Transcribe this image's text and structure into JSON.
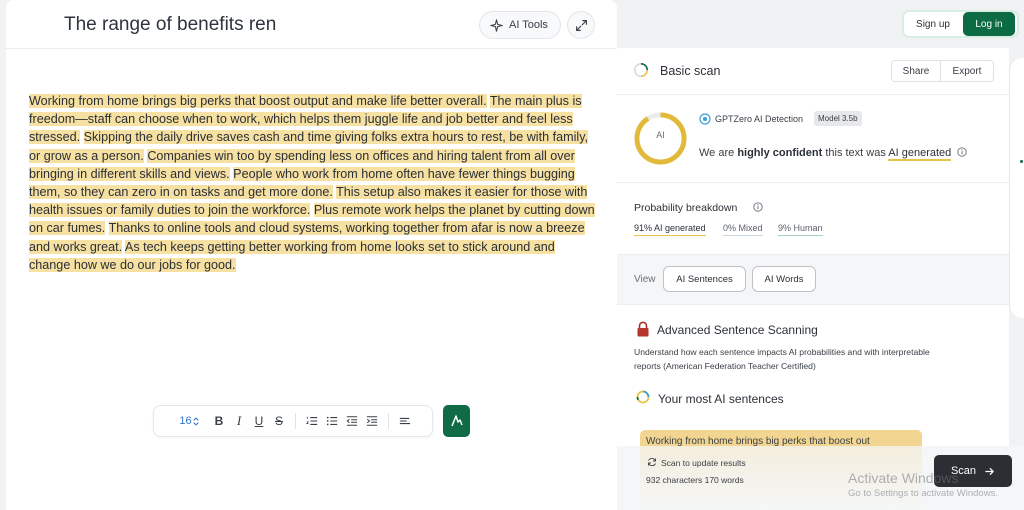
{
  "editor": {
    "title": "The range of benefits ren",
    "ai_tools_label": "AI Tools",
    "sentences": [
      "Working from home brings big perks that boost output and make life better overall.",
      "The main plus is freedom—staff can choose when to work, which helps them juggle life and job better and feel less stressed.",
      "Skipping the daily drive saves cash and time giving folks extra hours to rest, be with family, or grow as a person.",
      "Companies win too by spending less on offices and hiring talent from all over bringing in different skills and views.",
      "People who work from home often have fewer things bugging them, so they can zero in on tasks and get more done.",
      "This setup also makes it easier for those with health issues or family duties to join the workforce.",
      "Plus remote work helps the planet by cutting down on car fumes.",
      "Thanks to online tools and cloud systems, working together from afar is now a breeze and works great.",
      "As tech keeps getting better working from home looks set to stick around and change how we do our jobs for good."
    ],
    "toolbar": {
      "font_size": "16",
      "bold": "B",
      "italic": "I",
      "underline": "U",
      "strike": "S"
    }
  },
  "auth": {
    "signup": "Sign up",
    "login": "Log in"
  },
  "scan": {
    "title": "Basic scan",
    "share": "Share",
    "export": "Export",
    "ring_label": "AI",
    "detector_name": "GPTZero AI Detection",
    "model_badge": "Model 3.5b",
    "verdict_prefix": "We are ",
    "verdict_strong": "highly confident",
    "verdict_mid": " this text was ",
    "verdict_result": "AI generated",
    "probability_title": "Probability breakdown",
    "prob_ai": "91% AI generated",
    "prob_mixed": "0% Mixed",
    "prob_human": "9% Human",
    "prob_ai_value": 0.91,
    "view_label": "View",
    "view_sentences": "AI Sentences",
    "view_words": "AI Words",
    "advanced_title": "Advanced Sentence Scanning",
    "advanced_desc": "Understand how each sentence impacts AI probabilities and with interpretable reports (American Federation Teacher Certified)",
    "most_ai_title": "Your most AI sentences",
    "top_sentence": "Working from home brings big perks that boost out"
  },
  "footer": {
    "rescan": "Scan to update results",
    "counts": "932 characters 170 words",
    "scan_button": "Scan"
  },
  "watermark": {
    "line1": "Activate Windows",
    "line2": "Go to Settings to activate Windows."
  },
  "colors": {
    "highlight": "#f6e0a2",
    "brand_green": "#0d6b43",
    "ai_yellow": "#e8c34a"
  }
}
